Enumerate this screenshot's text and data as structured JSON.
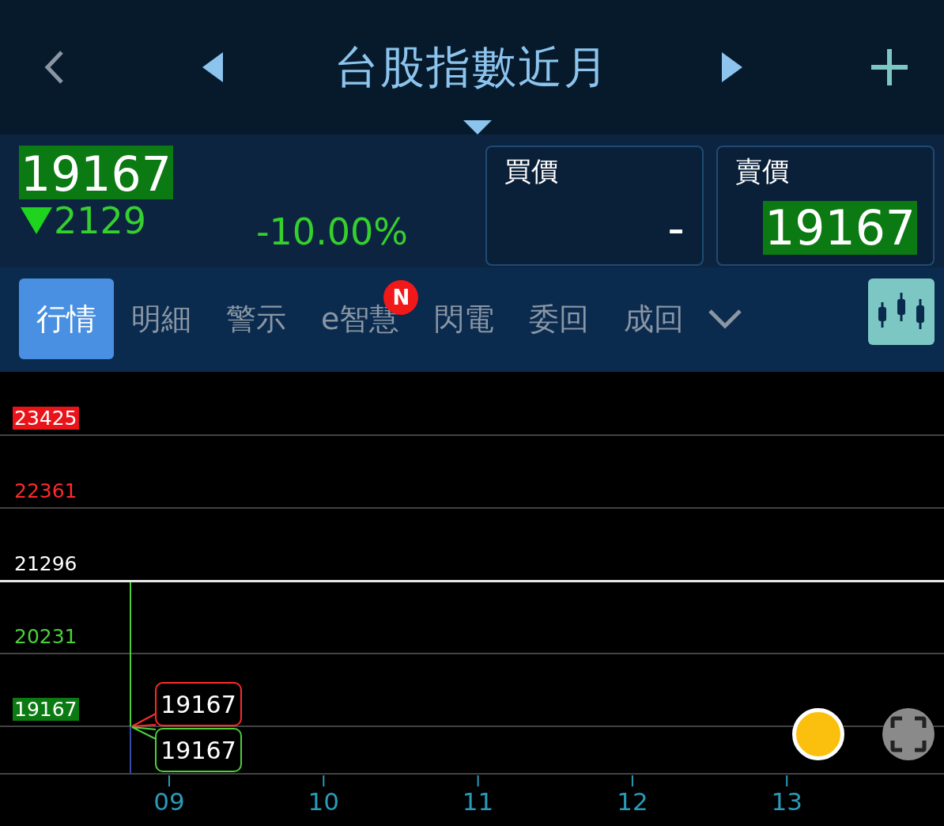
{
  "header": {
    "title": "台股指數近月"
  },
  "quote": {
    "price": "19167",
    "change": "2129",
    "falling": true,
    "percent": "-10.00%",
    "bid": {
      "label": "買價",
      "value": "-",
      "highlighted": false
    },
    "ask": {
      "label": "賣價",
      "value": "19167",
      "highlighted": true
    }
  },
  "tabs": [
    {
      "label": "行情",
      "selected": true
    },
    {
      "label": "明細",
      "selected": false
    },
    {
      "label": "警示",
      "selected": false
    },
    {
      "label": "e智慧",
      "selected": false,
      "badge": "N"
    },
    {
      "label": "閃電",
      "selected": false
    },
    {
      "label": "委回",
      "selected": false
    },
    {
      "label": "成回",
      "selected": false
    }
  ],
  "chart": {
    "price_levels": [
      {
        "label": "23425",
        "color": "#e8141a",
        "highlighted": true,
        "reference": false
      },
      {
        "label": "22361",
        "color": "#ff2a2a",
        "highlighted": false,
        "reference": false
      },
      {
        "label": "21296",
        "color": "#ffffff",
        "highlighted": false,
        "reference": true
      },
      {
        "label": "20231",
        "color": "#4ccf3a",
        "highlighted": false,
        "reference": false
      },
      {
        "label": "19167",
        "color": "#0c7a12",
        "highlighted": true,
        "reference": false
      }
    ],
    "callouts": [
      {
        "label": "19167",
        "color": "#ff2a2a"
      },
      {
        "label": "19167",
        "color": "#4ccf3a"
      }
    ],
    "time_ticks": [
      "09",
      "10",
      "11",
      "12",
      "13"
    ]
  }
}
